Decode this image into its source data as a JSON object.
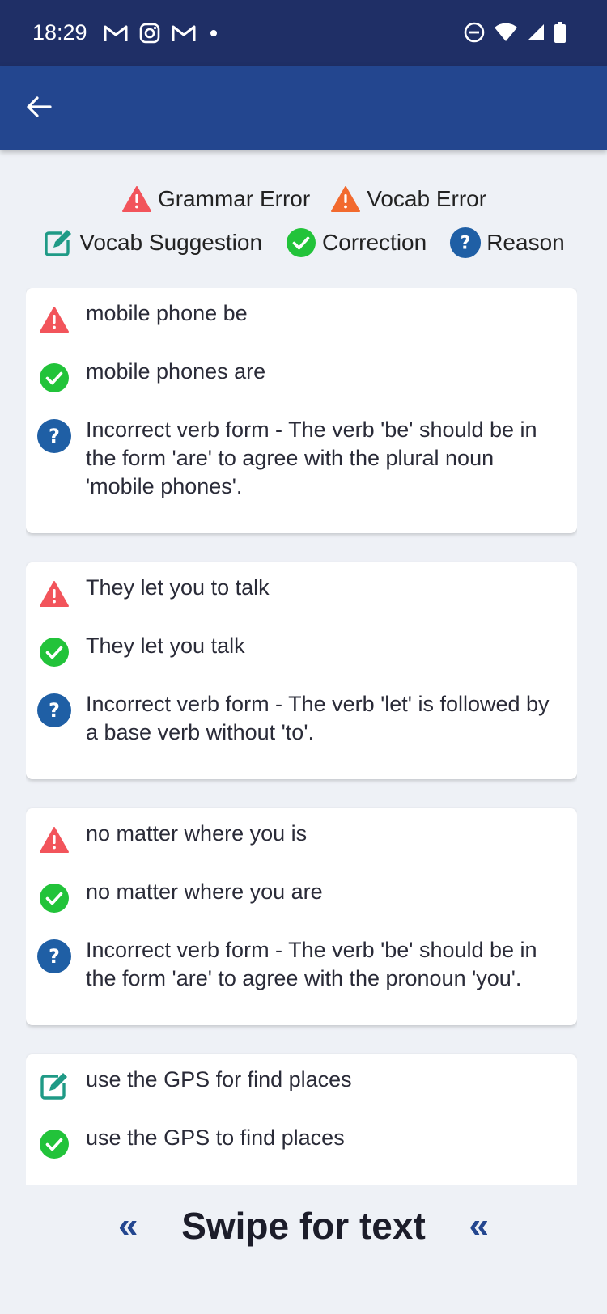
{
  "status_bar": {
    "time": "18:29",
    "notification_icons": [
      "gmail-icon",
      "instagram-icon",
      "gmail-icon",
      "dot-icon"
    ],
    "system_icons": [
      "do-not-disturb-icon",
      "wifi-icon",
      "cell-signal-icon",
      "battery-icon"
    ]
  },
  "app_bar": {
    "back_icon": "arrow-left-icon"
  },
  "legend": {
    "grammar_error": "Grammar Error",
    "vocab_error": "Vocab Error",
    "vocab_suggestion": "Vocab Suggestion",
    "correction": "Correction",
    "reason": "Reason"
  },
  "cards": [
    {
      "type": "grammar-error",
      "original": "mobile phone be",
      "correction": "mobile phones are",
      "reason": "Incorrect verb form - The verb 'be' should be in the form 'are' to agree with the plural noun 'mobile phones'."
    },
    {
      "type": "grammar-error",
      "original": "They let you to talk",
      "correction": "They let you talk",
      "reason": "Incorrect verb form - The verb 'let' is followed by a base verb without 'to'."
    },
    {
      "type": "grammar-error",
      "original": "no matter where you is",
      "correction": "no matter where you are",
      "reason": "Incorrect verb form - The verb 'be' should be in the form 'are' to agree with the pronoun 'you'."
    },
    {
      "type": "vocab-suggestion",
      "original": "use the GPS for find places",
      "correction": "use the GPS to find places"
    }
  ],
  "footer": {
    "swipe_text": "Swipe for text",
    "left_arrow": "«",
    "right_arrow": "«"
  },
  "colors": {
    "status_bar": "#1f2f66",
    "app_bar": "#23468f",
    "grammar_error": "#f2545b",
    "vocab_error": "#f26a2e",
    "vocab_suggestion": "#1f9a86",
    "correction": "#22c33a",
    "reason": "#1f5fa5",
    "background": "#eef1f6"
  }
}
